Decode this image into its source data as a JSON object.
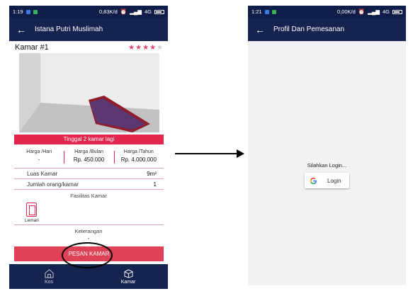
{
  "left_screen": {
    "status": {
      "time": "1:19",
      "speed": "0,83K/d",
      "network": "4G"
    },
    "appbar": {
      "back_icon": "arrow-left-icon",
      "title": "Istana Putri Muslimah"
    },
    "room": {
      "title": "Kamar #1",
      "rating": 4,
      "rating_max": 5
    },
    "banner": "Tinggal 2 kamar lagi",
    "prices": [
      {
        "label": "Harga /Hari",
        "value": "-"
      },
      {
        "label": "Harga /Bulan",
        "value": "Rp. 450.000"
      },
      {
        "label": "Harga /Tahun",
        "value": "Rp. 4.000.000"
      }
    ],
    "details": [
      {
        "label": "Luas Kamar",
        "value": "9m²"
      },
      {
        "label": "Jumlah orang/kamar",
        "value": "1"
      }
    ],
    "facilities_title": "Fasilitas Kamar",
    "facilities": [
      {
        "icon": "wardrobe-icon",
        "label": "Lemari"
      }
    ],
    "notes_title": "Keterangan",
    "notes_value": "-",
    "book_button": "PESAN KAMAR",
    "nav": [
      {
        "icon": "kos-icon",
        "label": "Kos"
      },
      {
        "icon": "kamar-icon",
        "label": "Kamar"
      }
    ]
  },
  "right_screen": {
    "status": {
      "time": "1:21",
      "speed": "0,00K/d",
      "network": "4G"
    },
    "appbar": {
      "back_icon": "arrow-left-icon",
      "title": "Profil Dan Pemesanan"
    },
    "login_prompt": "Silahkan Login...",
    "login_button": "Login"
  },
  "colors": {
    "primary_dark": "#15234f",
    "accent_red": "#e2264c",
    "button_red": "#df4257"
  }
}
